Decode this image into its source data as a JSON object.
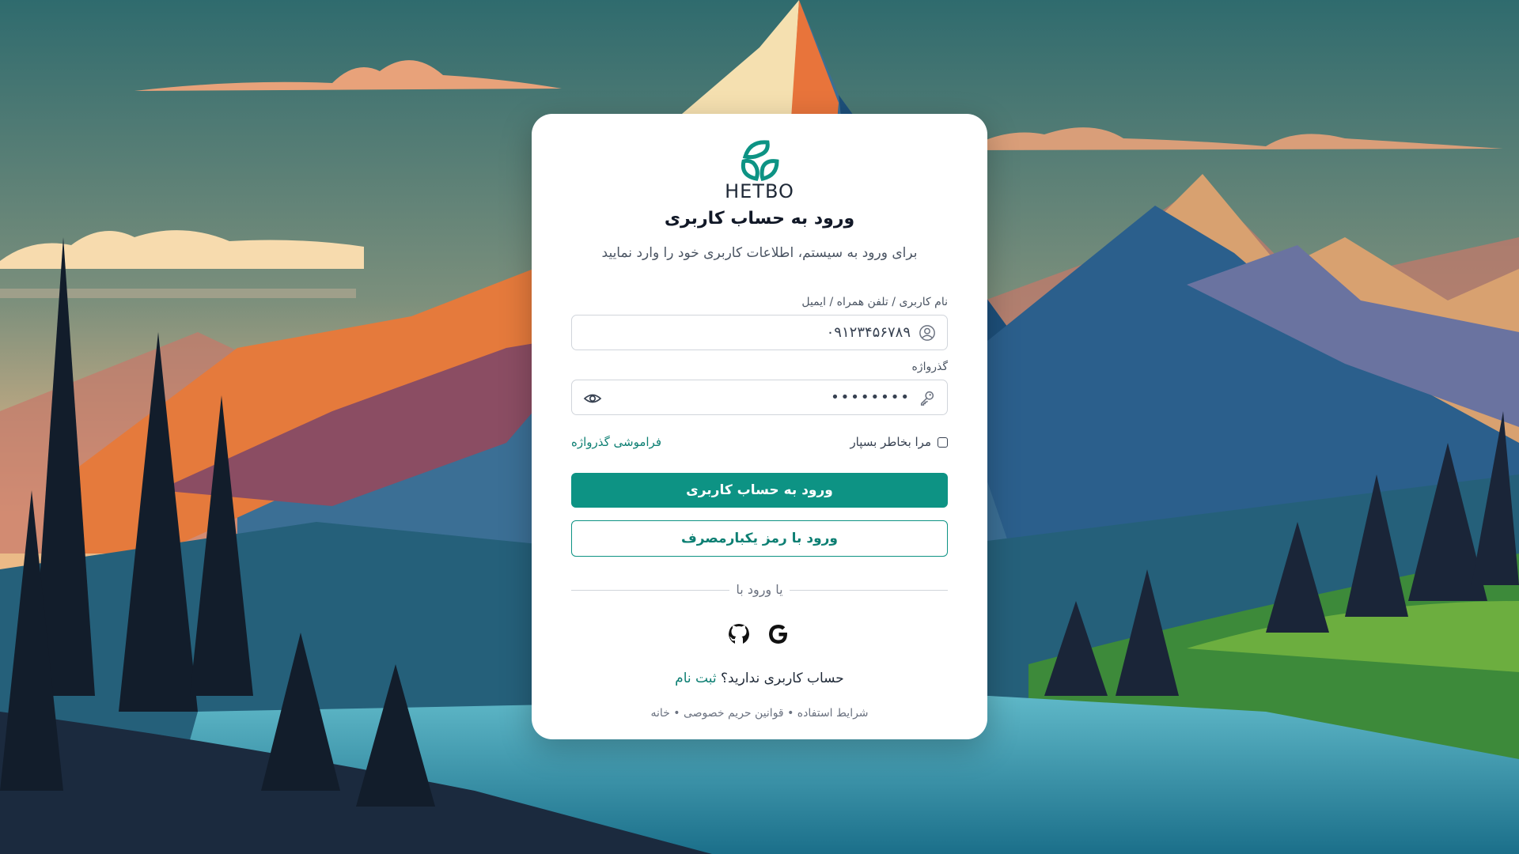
{
  "brand": {
    "name": "HETBO",
    "accent": "#0d9384"
  },
  "login": {
    "title": "ورود به حساب کاربری",
    "subtitle": "برای ورود به سیستم، اطلاعات کاربری خود را وارد نمایید",
    "username_label": "نام کاربری / تلفن همراه / ایمیل",
    "username_value": "۰۹۱۲۳۴۵۶۷۸۹",
    "password_label": "گذرواژه",
    "password_value": "••••••••",
    "remember_label": "مرا بخاطر بسپار",
    "remember_checked": false,
    "forgot_label": "فراموشی گذرواژه",
    "submit_label": "ورود به حساب کاربری",
    "otp_label": "ورود با رمز یکبارمصرف",
    "divider_label": "یا ورود با",
    "social": [
      "google-icon",
      "github-icon"
    ],
    "signup_prompt": "حساب کاربری ندارید؟",
    "signup_link": "ثبت نام",
    "footer": {
      "terms": "شرایط استفاده",
      "privacy": "قوانین حریم خصوصی",
      "home": "خانه",
      "separator": "•"
    }
  }
}
